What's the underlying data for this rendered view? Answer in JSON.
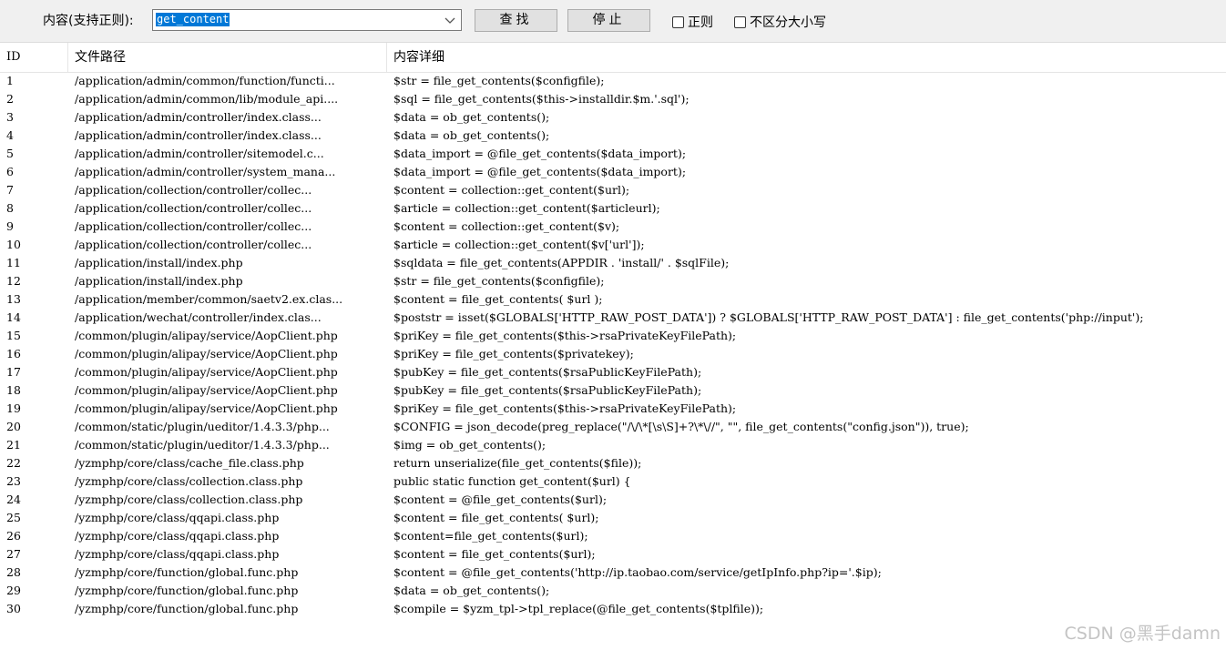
{
  "toolbar": {
    "search_label": "内容(支持正则):",
    "search_value": "get_content",
    "find_button": "查找",
    "stop_button": "停止",
    "regex_label": "正则",
    "case_label": "不区分大小写",
    "dropdown_icon": "chevron-down-icon"
  },
  "table": {
    "columns": [
      "ID",
      "文件路径",
      "内容详细"
    ],
    "rows": [
      {
        "id": "1",
        "path": "/application/admin/common/function/functi...",
        "detail": "$str = file_get_contents($configfile);"
      },
      {
        "id": "2",
        "path": "/application/admin/common/lib/module_api....",
        "detail": "$sql = file_get_contents($this->installdir.$m.'.sql');"
      },
      {
        "id": "3",
        "path": "/application/admin/controller/index.class...",
        "detail": "$data = ob_get_contents();"
      },
      {
        "id": "4",
        "path": "/application/admin/controller/index.class...",
        "detail": "$data = ob_get_contents();"
      },
      {
        "id": "5",
        "path": "/application/admin/controller/sitemodel.c...",
        "detail": "$data_import = @file_get_contents($data_import);"
      },
      {
        "id": "6",
        "path": "/application/admin/controller/system_mana...",
        "detail": "$data_import = @file_get_contents($data_import);"
      },
      {
        "id": "7",
        "path": "/application/collection/controller/collec...",
        "detail": "$content = collection::get_content($url);"
      },
      {
        "id": "8",
        "path": "/application/collection/controller/collec...",
        "detail": "$article = collection::get_content($articleurl);"
      },
      {
        "id": "9",
        "path": "/application/collection/controller/collec...",
        "detail": "$content = collection::get_content($v);"
      },
      {
        "id": "10",
        "path": "/application/collection/controller/collec...",
        "detail": "$article = collection::get_content($v['url']);"
      },
      {
        "id": "11",
        "path": "/application/install/index.php",
        "detail": "$sqldata = file_get_contents(APPDIR . 'install/' . $sqlFile);"
      },
      {
        "id": "12",
        "path": "/application/install/index.php",
        "detail": "$str = file_get_contents($configfile);"
      },
      {
        "id": "13",
        "path": "/application/member/common/saetv2.ex.clas...",
        "detail": "$content = file_get_contents( $url );"
      },
      {
        "id": "14",
        "path": "/application/wechat/controller/index.clas...",
        "detail": "$poststr = isset($GLOBALS['HTTP_RAW_POST_DATA']) ? $GLOBALS['HTTP_RAW_POST_DATA'] : file_get_contents('php://input');"
      },
      {
        "id": "15",
        "path": "/common/plugin/alipay/service/AopClient.php",
        "detail": "$priKey = file_get_contents($this->rsaPrivateKeyFilePath);"
      },
      {
        "id": "16",
        "path": "/common/plugin/alipay/service/AopClient.php",
        "detail": "$priKey = file_get_contents($privatekey);"
      },
      {
        "id": "17",
        "path": "/common/plugin/alipay/service/AopClient.php",
        "detail": "$pubKey = file_get_contents($rsaPublicKeyFilePath);"
      },
      {
        "id": "18",
        "path": "/common/plugin/alipay/service/AopClient.php",
        "detail": "$pubKey = file_get_contents($rsaPublicKeyFilePath);"
      },
      {
        "id": "19",
        "path": "/common/plugin/alipay/service/AopClient.php",
        "detail": "$priKey = file_get_contents($this->rsaPrivateKeyFilePath);"
      },
      {
        "id": "20",
        "path": "/common/static/plugin/ueditor/1.4.3.3/php...",
        "detail": "$CONFIG = json_decode(preg_replace(\"/\\/\\*[\\s\\S]+?\\*\\//\", \"\", file_get_contents(\"config.json\")), true);"
      },
      {
        "id": "21",
        "path": "/common/static/plugin/ueditor/1.4.3.3/php...",
        "detail": "$img = ob_get_contents();"
      },
      {
        "id": "22",
        "path": "/yzmphp/core/class/cache_file.class.php",
        "detail": "return unserialize(file_get_contents($file));"
      },
      {
        "id": "23",
        "path": "/yzmphp/core/class/collection.class.php",
        "detail": "public static function get_content($url) {"
      },
      {
        "id": "24",
        "path": "/yzmphp/core/class/collection.class.php",
        "detail": "$content = @file_get_contents($url);"
      },
      {
        "id": "25",
        "path": "/yzmphp/core/class/qqapi.class.php",
        "detail": "$content = file_get_contents( $url);"
      },
      {
        "id": "26",
        "path": "/yzmphp/core/class/qqapi.class.php",
        "detail": "$content=file_get_contents($url);"
      },
      {
        "id": "27",
        "path": "/yzmphp/core/class/qqapi.class.php",
        "detail": "$content = file_get_contents($url);"
      },
      {
        "id": "28",
        "path": "/yzmphp/core/function/global.func.php",
        "detail": "$content = @file_get_contents('http://ip.taobao.com/service/getIpInfo.php?ip='.$ip);"
      },
      {
        "id": "29",
        "path": "/yzmphp/core/function/global.func.php",
        "detail": "$data = ob_get_contents();"
      },
      {
        "id": "30",
        "path": "/yzmphp/core/function/global.func.php",
        "detail": "$compile = $yzm_tpl->tpl_replace(@file_get_contents($tplfile));"
      }
    ]
  },
  "watermark": "CSDN @黑手damn"
}
